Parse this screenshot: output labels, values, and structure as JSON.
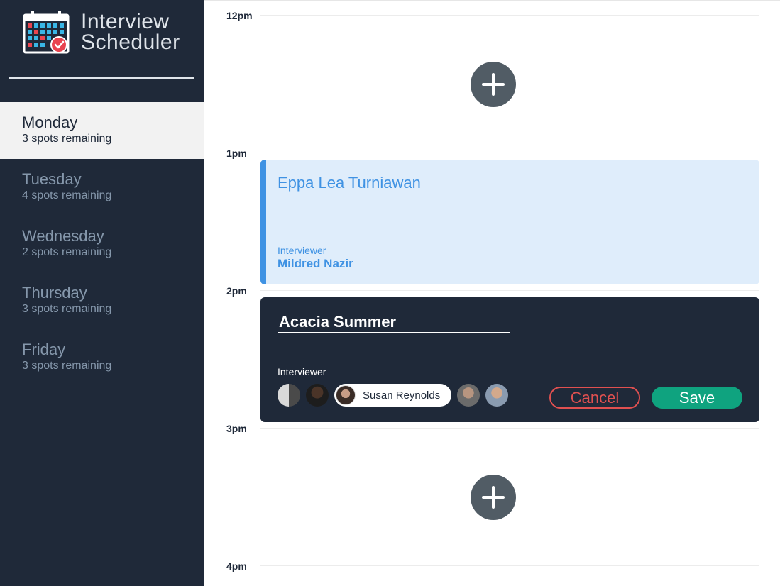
{
  "app": {
    "title_line1": "Interview",
    "title_line2": "Scheduler",
    "logo_icon": "calendar-check-icon"
  },
  "days": [
    {
      "name": "Monday",
      "spots": "3 spots remaining",
      "selected": true
    },
    {
      "name": "Tuesday",
      "spots": "4 spots remaining",
      "selected": false
    },
    {
      "name": "Wednesday",
      "spots": "2 spots remaining",
      "selected": false
    },
    {
      "name": "Thursday",
      "spots": "3 spots remaining",
      "selected": false
    },
    {
      "name": "Friday",
      "spots": "3 spots remaining",
      "selected": false
    }
  ],
  "schedule": {
    "hours": [
      "12pm",
      "1pm",
      "2pm",
      "3pm",
      "4pm"
    ],
    "add_icon": "plus-icon"
  },
  "booked": {
    "student": "Eppa Lea Turniawan",
    "interviewer_label": "Interviewer",
    "interviewer": "Mildred Nazir"
  },
  "editing": {
    "student_value": "Acacia Summer",
    "interviewer_label": "Interviewer",
    "selected_interviewer": "Susan Reynolds",
    "cancel_label": "Cancel",
    "save_label": "Save"
  },
  "colors": {
    "sidebar_bg": "#1f2939",
    "accent_blue": "#3f92e3",
    "booked_bg": "#dfedfb",
    "cancel_red": "#e05050",
    "save_green": "#0fa37f"
  }
}
